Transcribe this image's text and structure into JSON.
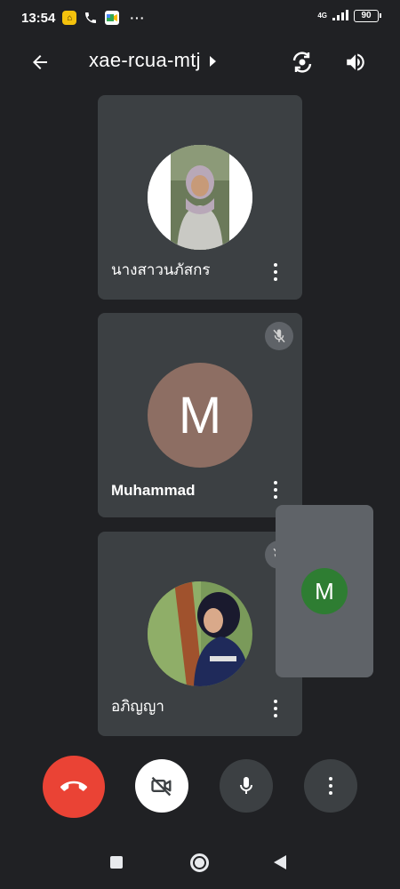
{
  "status_bar": {
    "time": "13:54",
    "network_type": "4G",
    "battery": "90",
    "more": "···"
  },
  "header": {
    "meeting_code": "xae-rcua-mtj",
    "icons": [
      "arrow-back-icon",
      "caret-right-icon",
      "switch-camera-icon",
      "volume-up-icon"
    ]
  },
  "participants": [
    {
      "name": "นางสาวนภัสกร",
      "avatar": "photo",
      "muted": false
    },
    {
      "name": "Muhammad",
      "avatar": "letter",
      "initial": "M",
      "avatar_color": "#8d6e63",
      "muted": true
    },
    {
      "name": "อภิญญา",
      "avatar": "photo",
      "muted": true
    }
  ],
  "self_view": {
    "initial": "M",
    "avatar_color": "#2e7d32"
  },
  "controls": {
    "end_call_color": "#ea4335",
    "icons": [
      "end-call-icon",
      "camera-off-icon",
      "mic-icon",
      "more-vert-icon"
    ]
  },
  "colors": {
    "background": "#202124",
    "tile": "#3c4043",
    "self_view": "#5f6368"
  }
}
